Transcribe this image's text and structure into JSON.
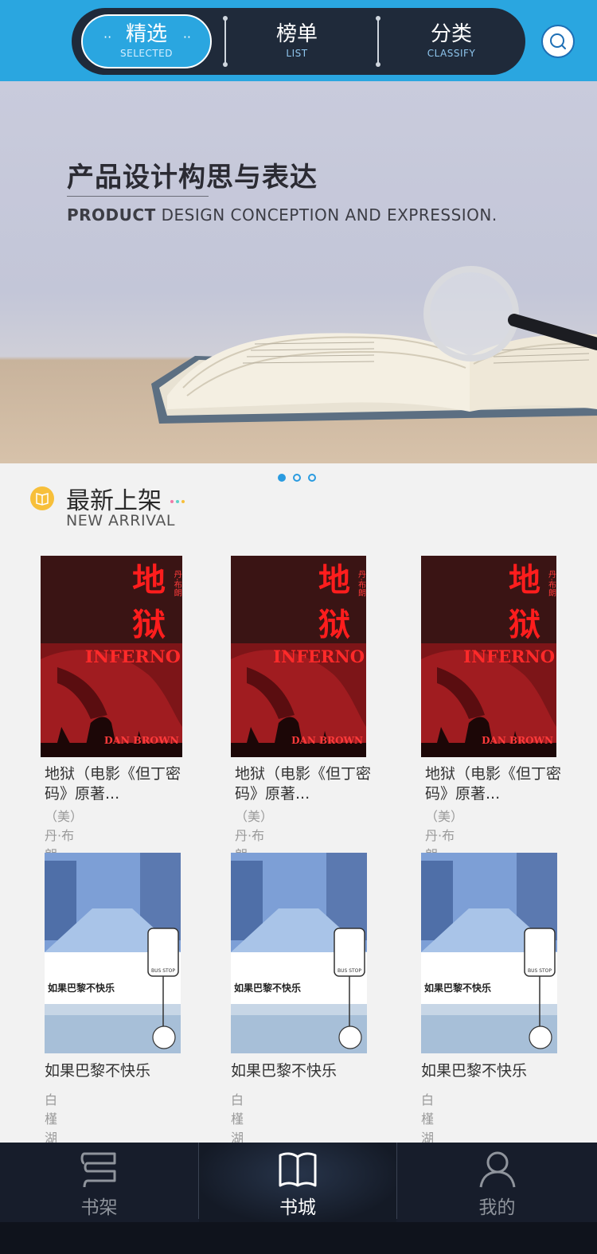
{
  "header": {
    "tabs": [
      {
        "label": "精选",
        "sublabel": "SELECTED",
        "active": true
      },
      {
        "label": "榜单",
        "sublabel": "LIST",
        "active": false
      },
      {
        "label": "分类",
        "sublabel": "CLASSIFY",
        "active": false
      }
    ],
    "search_icon": "search-icon",
    "accent_color": "#2aa6e0",
    "dark_color": "#1f2a3a"
  },
  "banner": {
    "title": "产品设计构思与表达",
    "subtitle_bold": "PRODUCT",
    "subtitle_rest": " DESIGN CONCEPTION AND EXPRESSION.",
    "pages_total": 3,
    "page_current": 1
  },
  "section": {
    "title": "最新上架",
    "subtitle": "NEW ARRIVAL",
    "icon": "book-icon"
  },
  "books": [
    {
      "title": "地狱（电影《但丁密码》原著...",
      "author": "（美）丹·布朗",
      "cover": "inferno"
    },
    {
      "title": "地狱（电影《但丁密码》原著...",
      "author": "（美）丹·布朗",
      "cover": "inferno"
    },
    {
      "title": "地狱（电影《但丁密码》原著...",
      "author": "（美）丹·布朗",
      "cover": "inferno"
    },
    {
      "title": "如果巴黎不快乐",
      "author": "白槿湖",
      "cover": "paris"
    },
    {
      "title": "如果巴黎不快乐",
      "author": "白槿湖",
      "cover": "paris"
    },
    {
      "title": "如果巴黎不快乐",
      "author": "白槿湖",
      "cover": "paris"
    }
  ],
  "covers": {
    "inferno": {
      "zh_line1": "地",
      "zh_line2": "狱",
      "author_vertical": "丹·布朗",
      "en_title": "INFERNO",
      "en_author": "DAN BROWN"
    },
    "paris": {
      "title": "如果巴黎不快乐",
      "sign": "BUS STOP"
    }
  },
  "bottom_nav": [
    {
      "label": "书架",
      "icon": "bookshelf-icon",
      "active": false
    },
    {
      "label": "书城",
      "icon": "open-book-icon",
      "active": true
    },
    {
      "label": "我的",
      "icon": "user-icon",
      "active": false
    }
  ]
}
